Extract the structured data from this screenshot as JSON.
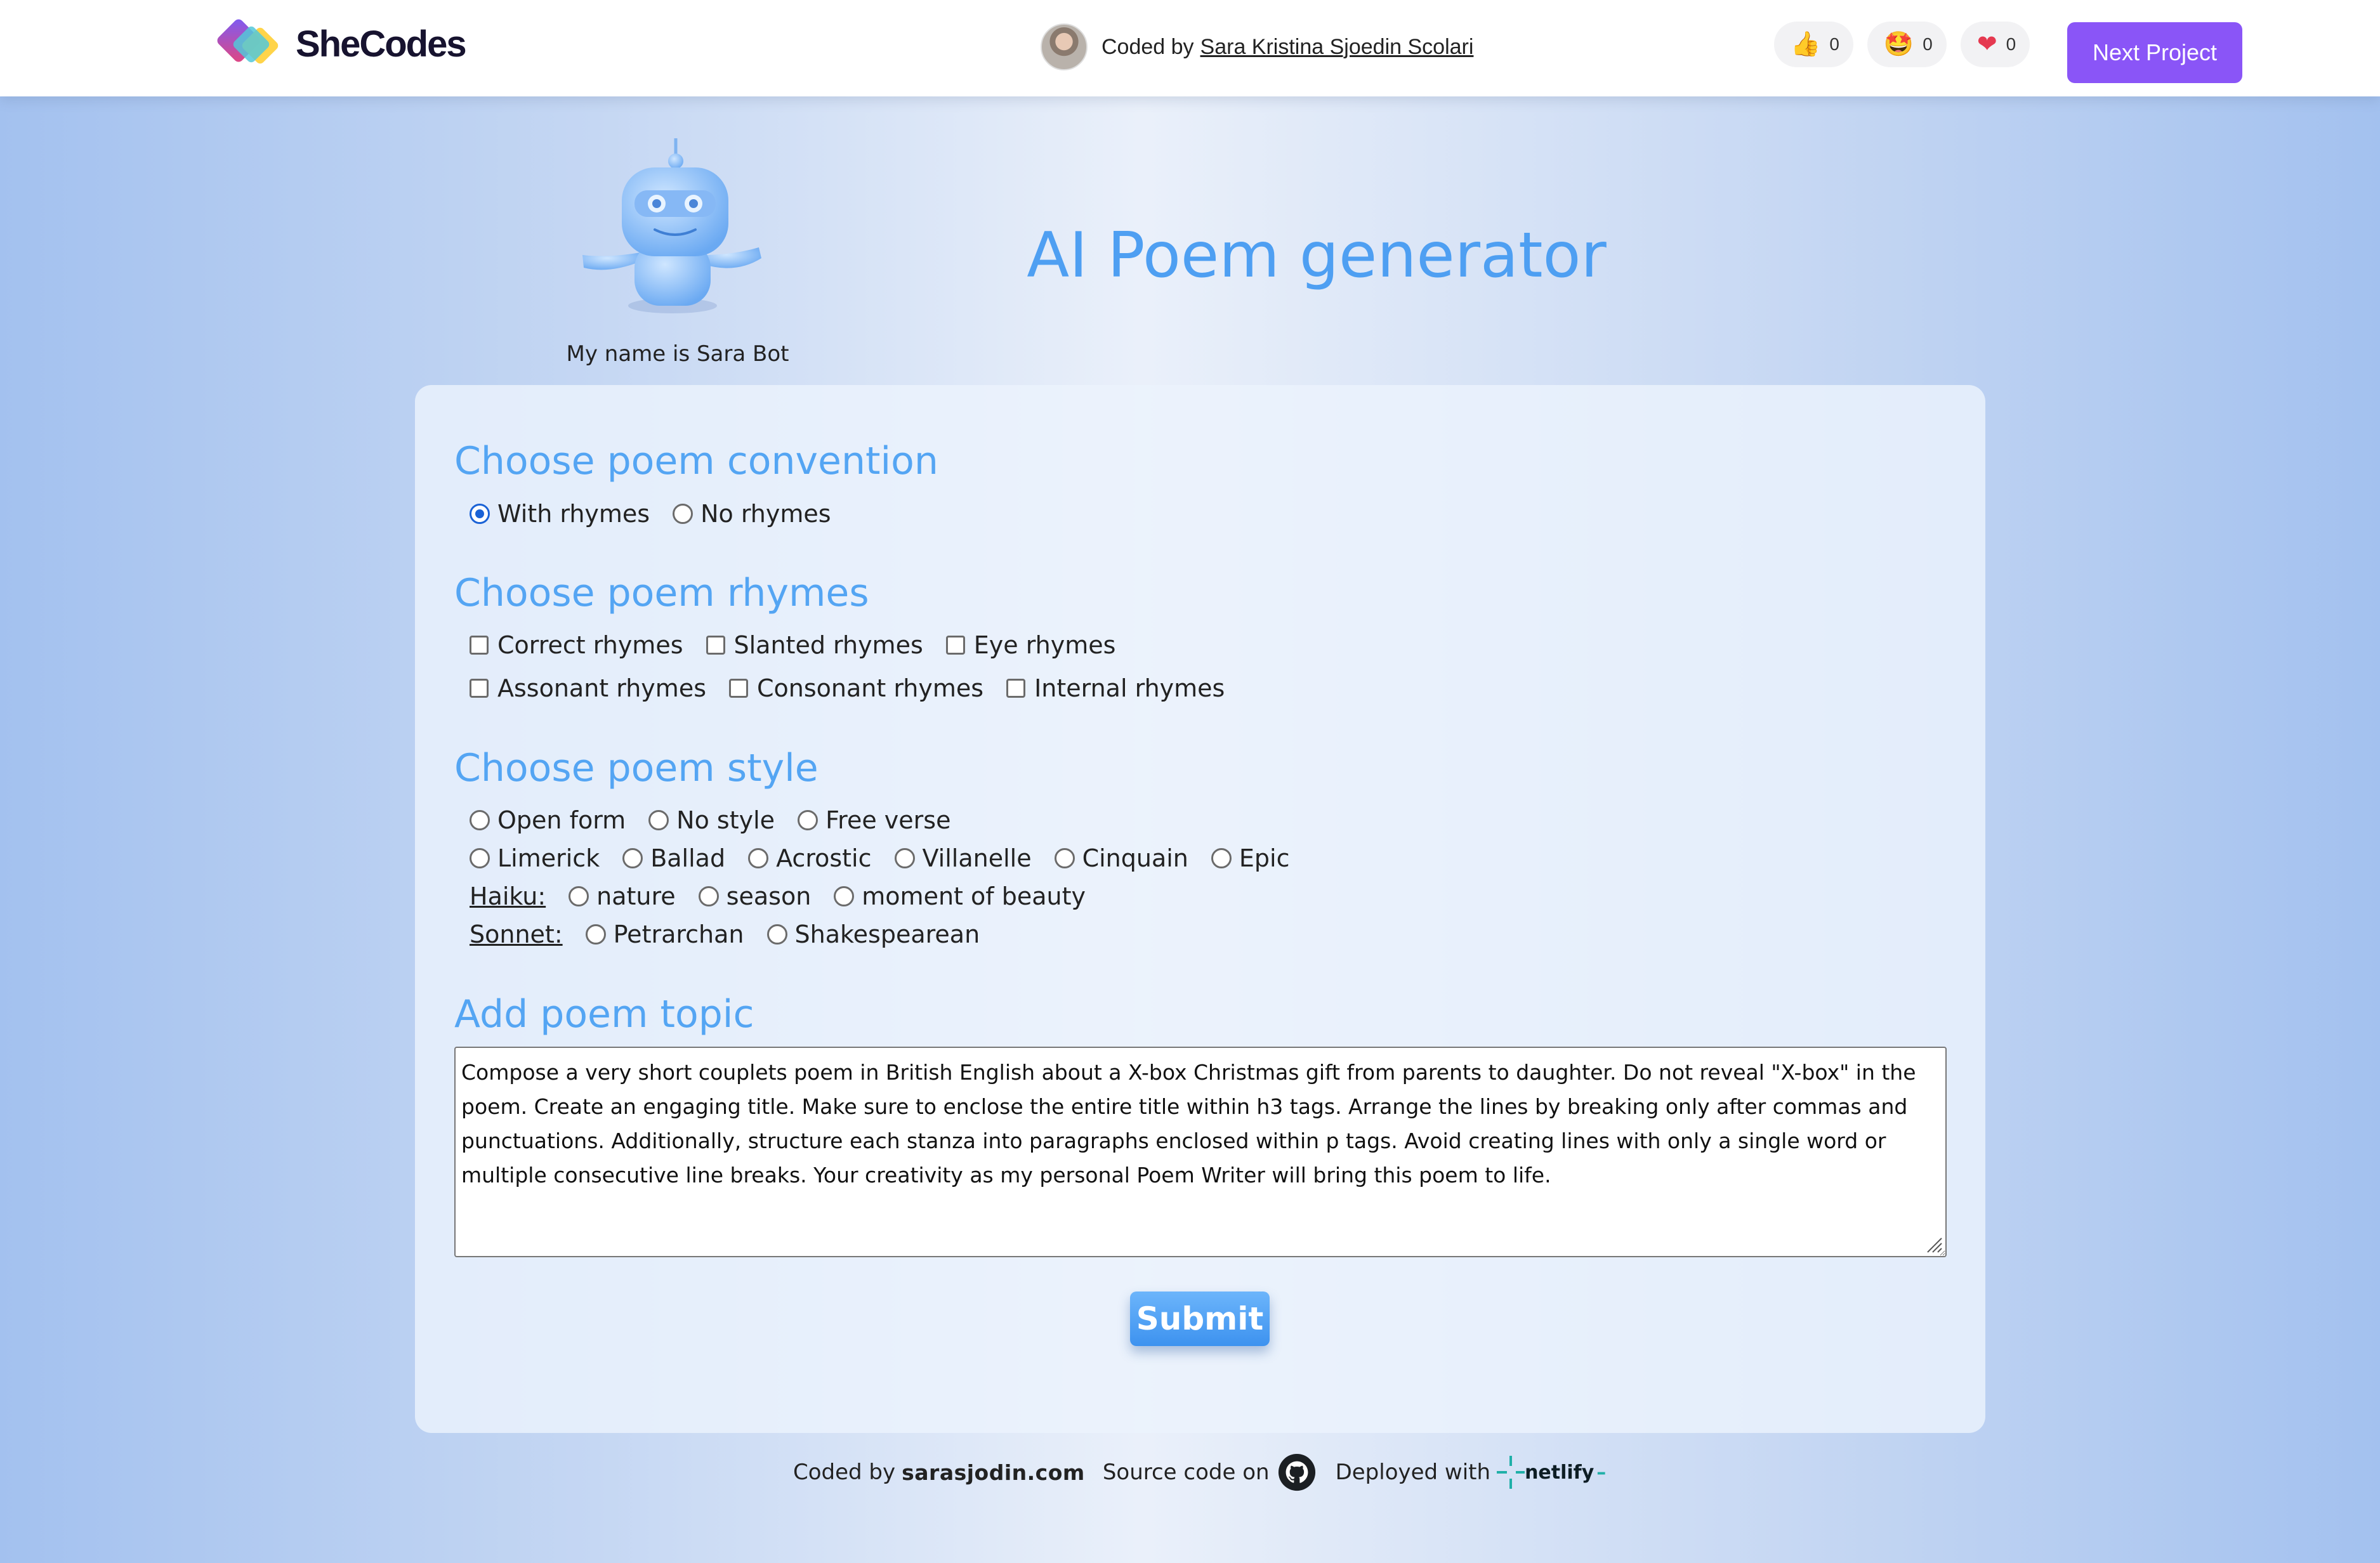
{
  "header": {
    "brand": "SheCodes",
    "coded_by_prefix": "Coded by",
    "author_name": "Sara Kristina Sjoedin Scolari",
    "reactions": [
      {
        "icon": "thumbs-up-icon",
        "glyph": "👍",
        "count": "0"
      },
      {
        "icon": "star-struck-icon",
        "glyph": "🤩",
        "count": "0"
      },
      {
        "icon": "heart-icon",
        "glyph": "❤",
        "count": "0"
      }
    ],
    "next_button": "Next Project"
  },
  "hero": {
    "title": "AI Poem generator",
    "robot_caption": "My name is Sara Bot"
  },
  "form": {
    "convention": {
      "title": "Choose poem convention",
      "options": [
        {
          "label": "With rhymes",
          "checked": true
        },
        {
          "label": "No rhymes",
          "checked": false
        }
      ]
    },
    "rhymes": {
      "title": "Choose poem rhymes",
      "row1": [
        "Correct rhymes",
        "Slanted rhymes",
        "Eye rhymes"
      ],
      "row2": [
        "Assonant rhymes",
        "Consonant rhymes",
        "Internal rhymes"
      ]
    },
    "style": {
      "title": "Choose poem style",
      "row1": [
        "Open form",
        "No style",
        "Free verse"
      ],
      "row2": [
        "Limerick",
        "Ballad",
        "Acrostic",
        "Villanelle",
        "Cinquain",
        "Epic"
      ],
      "haiku_label": "Haiku:",
      "haiku": [
        "nature",
        "season",
        "moment of beauty"
      ],
      "sonnet_label": "Sonnet:",
      "sonnet": [
        "Petrarchan",
        "Shakespearean"
      ]
    },
    "topic": {
      "title": "Add poem topic",
      "value": "Compose a very short couplets poem in British English about a X-box Christmas gift from parents to daughter. Do not reveal \"X-box\" in the poem. Create an engaging title. Make sure to enclose the entire title within h3 tags. Arrange the lines by breaking only after commas and punctuations. Additionally, structure each stanza into paragraphs enclosed within p tags. Avoid creating lines with only a single word or multiple consecutive line breaks. Your creativity as my personal Poem Writer will bring this poem to life."
    },
    "submit": "Submit"
  },
  "footer": {
    "coded_by": "Coded by",
    "site": "sarasjodin.com",
    "source": "Source code on",
    "deployed": "Deployed with",
    "netlify": "netlify"
  },
  "colors": {
    "accent": "#54a5f3",
    "title": "#4e9ff2",
    "next_button": "#8a55f7",
    "radio_checked": "#1a62d6"
  }
}
